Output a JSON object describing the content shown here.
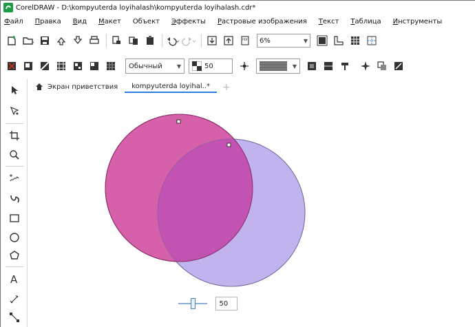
{
  "window": {
    "title": "CorelDRAW - D:\\kompyuterda loyihalash\\kompyuterda loyihalash.cdr*",
    "logo_icon": "coreldraw-logo-icon"
  },
  "menu": [
    {
      "label": "Файл",
      "mnemonic": "Ф"
    },
    {
      "label": "Правка",
      "mnemonic": "П"
    },
    {
      "label": "Вид",
      "mnemonic": "В"
    },
    {
      "label": "Макет",
      "mnemonic": "М"
    },
    {
      "label": "Объект",
      "mnemonic": ""
    },
    {
      "label": "Эффекты",
      "mnemonic": "Э"
    },
    {
      "label": "Растровые изображения",
      "mnemonic": "Р"
    },
    {
      "label": "Текст",
      "mnemonic": "Т"
    },
    {
      "label": "Таблица",
      "mnemonic": "Т"
    },
    {
      "label": "Инструменты",
      "mnemonic": "И"
    }
  ],
  "standard_toolbar": {
    "zoom_value": "6%",
    "icons": [
      "new-document-icon",
      "open-icon",
      "save-icon",
      "import-icon",
      "export-icon",
      "print-icon",
      "cut-icon",
      "copy-icon",
      "paste-icon",
      "undo-icon",
      "redo-icon",
      "import-arrow-icon",
      "export-arrow-icon",
      "pdf-icon",
      "full-screen-icon",
      "rulers-icon",
      "grid-icon",
      "guidelines-icon"
    ]
  },
  "property_bar": {
    "merge_mode": "Обычный",
    "opacity_value": "50"
  },
  "tabs": [
    {
      "label": "Экран приветствия",
      "icon": "home-icon",
      "active": false
    },
    {
      "label": "kompyuterda loyihal..*",
      "active": true
    }
  ],
  "toolbox": [
    "pick-tool-icon",
    "shape-tool-icon",
    "crop-tool-icon",
    "zoom-tool-icon",
    "freehand-tool-icon",
    "artistic-media-icon",
    "rectangle-tool-icon",
    "ellipse-tool-icon",
    "polygon-tool-icon",
    "text-tool-icon",
    "parallel-dimension-icon",
    "connector-tool-icon"
  ],
  "canvas": {
    "slider_value": "50",
    "colors": {
      "pink_circle": "#d04a9e",
      "purple_circle": "#b6a6ea",
      "overlap": "#c24fb0"
    }
  }
}
